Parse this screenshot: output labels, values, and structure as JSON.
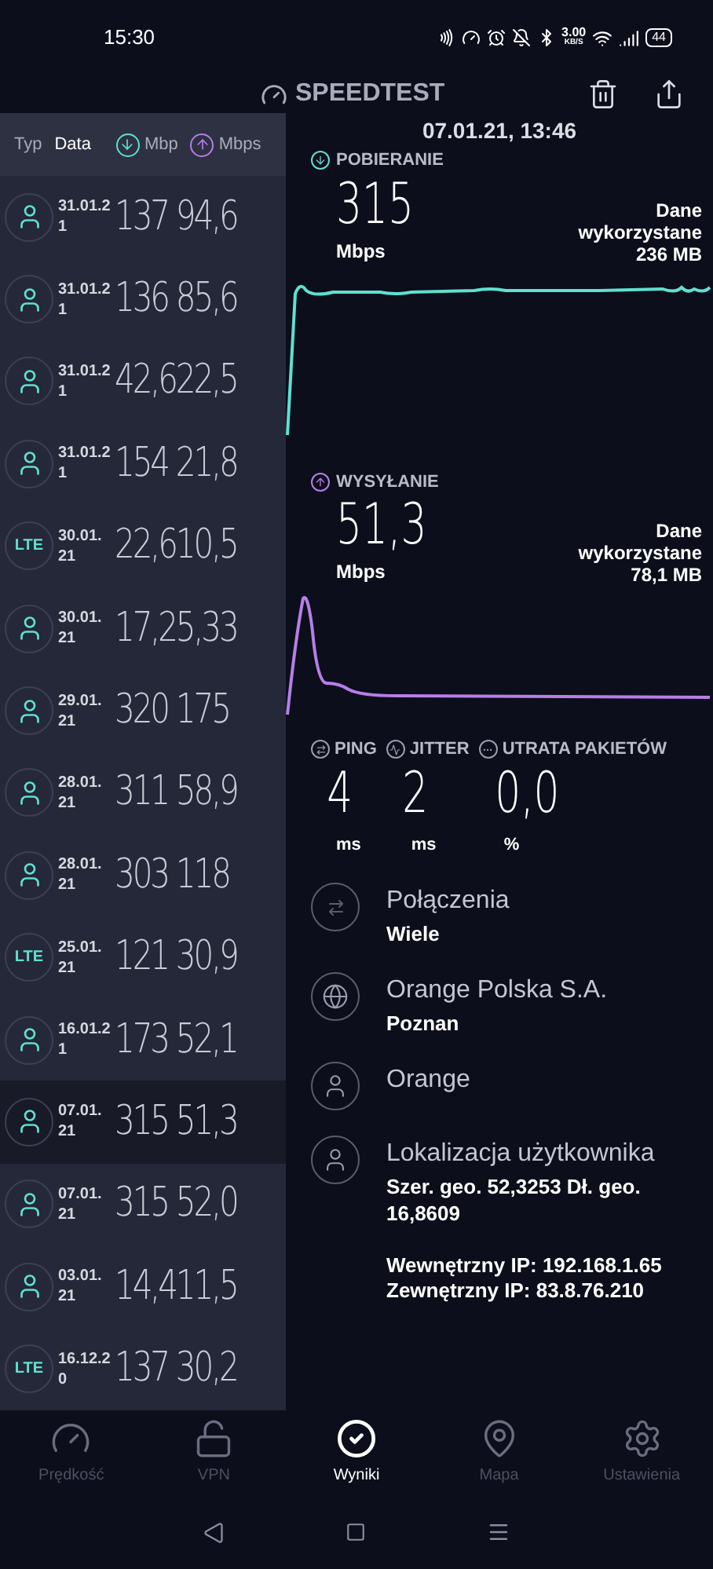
{
  "status_bar": {
    "time": "15:30",
    "net_speed": "3.00",
    "net_unit": "KB/S",
    "battery": "44"
  },
  "header": {
    "title": "SPEEDTEST"
  },
  "history": {
    "columns": [
      {
        "label": "Typ",
        "kind": "text"
      },
      {
        "label": "Data",
        "kind": "text"
      },
      {
        "label": "Mbp",
        "kind": "download"
      },
      {
        "label": "Mbps",
        "kind": "upload"
      }
    ],
    "rows": [
      {
        "kind": "user",
        "date": [
          "31.01.2",
          "1"
        ],
        "speeds": "137 94,6",
        "selected": false
      },
      {
        "kind": "user",
        "date": [
          "31.01.2",
          "1"
        ],
        "speeds": "136 85,6",
        "selected": false
      },
      {
        "kind": "user",
        "date": [
          "31.01.2",
          "1"
        ],
        "speeds": "42,622,5",
        "selected": false
      },
      {
        "kind": "user",
        "date": [
          "31.01.2",
          "1"
        ],
        "speeds": "154 21,8",
        "selected": false
      },
      {
        "kind": "lte",
        "badge": "LTE",
        "date": [
          "30.01.",
          "21"
        ],
        "speeds": "22,610,5",
        "selected": false
      },
      {
        "kind": "user",
        "date": [
          "30.01.",
          "21"
        ],
        "speeds": "17,25,33",
        "selected": false
      },
      {
        "kind": "user",
        "date": [
          "29.01.",
          "21"
        ],
        "speeds": "320 175",
        "selected": false
      },
      {
        "kind": "user",
        "date": [
          "28.01.",
          "21"
        ],
        "speeds": "311 58,9",
        "selected": false
      },
      {
        "kind": "user",
        "date": [
          "28.01.",
          "21"
        ],
        "speeds": "303 118",
        "selected": false
      },
      {
        "kind": "lte",
        "badge": "LTE",
        "date": [
          "25.01.",
          "21"
        ],
        "speeds": "121 30,9",
        "selected": false
      },
      {
        "kind": "user",
        "date": [
          "16.01.2",
          "1"
        ],
        "speeds": "173 52,1",
        "selected": false
      },
      {
        "kind": "user",
        "date": [
          "07.01.",
          "21"
        ],
        "speeds": "315 51,3",
        "selected": true
      },
      {
        "kind": "user",
        "date": [
          "07.01.",
          "21"
        ],
        "speeds": "315 52,0",
        "selected": false
      },
      {
        "kind": "user",
        "date": [
          "03.01.",
          "21"
        ],
        "speeds": "14,411,5",
        "selected": false
      },
      {
        "kind": "lte",
        "badge": "LTE",
        "date": [
          "16.12.2",
          "0"
        ],
        "speeds": "137 30,2",
        "selected": false
      }
    ]
  },
  "detail": {
    "date": "07.01.21, 13:46",
    "tests": [
      {
        "kind": "download",
        "label": "POBIERANIE",
        "value": "315",
        "unit": "Mbps",
        "data_label": [
          "Dane",
          "wykorzystane"
        ],
        "data_value": "236 MB"
      },
      {
        "kind": "upload",
        "label": "WYSYŁANIE",
        "value": "51,3",
        "unit": "Mbps",
        "data_label": [
          "Dane",
          "wykorzystane"
        ],
        "data_value": "78,1 MB"
      }
    ],
    "metrics": [
      {
        "kind": "ping",
        "label": "PING",
        "value": "4",
        "unit": "ms"
      },
      {
        "kind": "jitter",
        "label": "JITTER",
        "value": "2",
        "unit": "ms"
      },
      {
        "kind": "loss",
        "label": "UTRATA PAKIETÓW",
        "value": "0,0",
        "unit": "%"
      }
    ],
    "info": [
      {
        "kind": "connections",
        "title": "Połączenia",
        "lines": [
          "Wiele"
        ]
      },
      {
        "kind": "server",
        "title": "Orange Polska S.A.",
        "lines": [
          "Poznan"
        ]
      },
      {
        "kind": "provider",
        "title": "Orange"
      },
      {
        "kind": "location",
        "title": "Lokalizacja użytkownika",
        "lines": [
          "Szer. geo. 52,3253 Dł. geo. 16,8609"
        ],
        "extra": [
          "Wewnętrzny IP: 192.168.1.65",
          "Zewnętrzny IP: 83.8.76.210"
        ]
      }
    ]
  },
  "tabs": [
    {
      "label": "Prędkość",
      "kind": "speed",
      "selected": false
    },
    {
      "label": "VPN",
      "kind": "vpn",
      "selected": false
    },
    {
      "label": "Wyniki",
      "kind": "results",
      "selected": true
    },
    {
      "label": "Mapa",
      "kind": "map",
      "selected": false
    },
    {
      "label": "Ustawienia",
      "kind": "settings",
      "selected": false
    }
  ]
}
